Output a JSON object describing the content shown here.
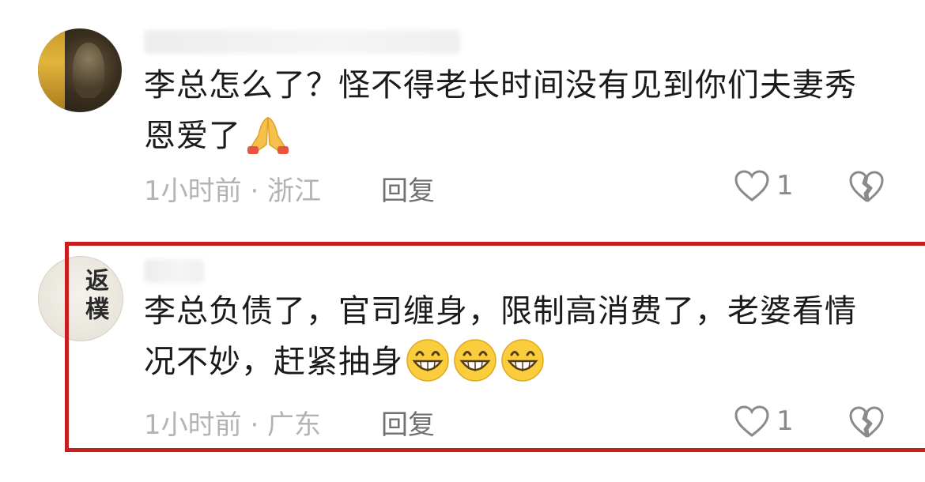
{
  "comments": [
    {
      "username": "",
      "text": "李总怎么了？怪不得老长时间没有见到你们夫妻秀恩爱了",
      "emoji": "folded-hands-emoji",
      "time_location": "1小时前 · 浙江",
      "reply_label": "回复",
      "like_count": "1"
    },
    {
      "username": "",
      "text": "李总负债了，官司缠身，限制高消费了，老婆看情况不妙，赶紧抽身",
      "emoji": "grinning-face-emoji",
      "emoji_count": 3,
      "avatar_text": "返樸",
      "time_location": "1小时前 · 广东",
      "reply_label": "回复",
      "like_count": "1"
    }
  ],
  "colors": {
    "highlight": "#c81e1e",
    "meta_text": "#b3b3b3",
    "reply_text": "#6f6f6f",
    "body_text": "#1a1a1a"
  }
}
